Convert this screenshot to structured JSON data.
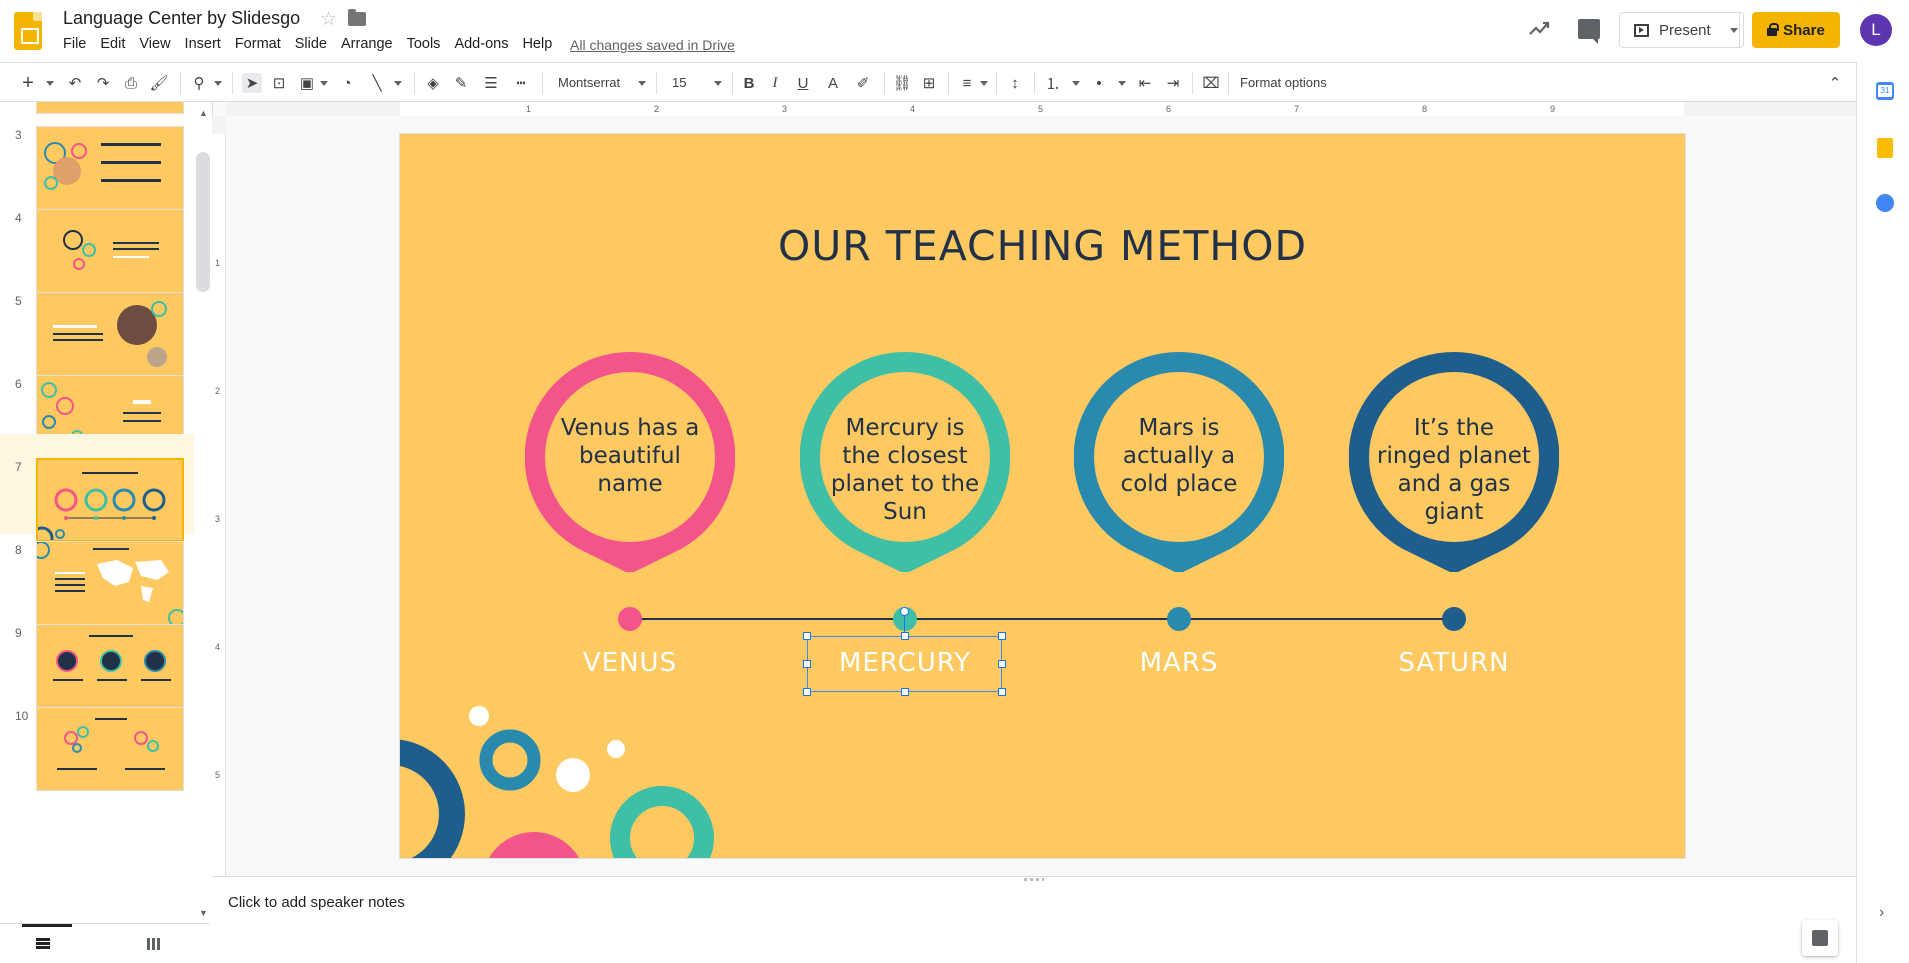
{
  "app": {
    "doc_title": "Language Center by Slidesgo",
    "menu": [
      "File",
      "Edit",
      "View",
      "Insert",
      "Format",
      "Slide",
      "Arrange",
      "Tools",
      "Add-ons",
      "Help"
    ],
    "save_status": "All changes saved in Drive",
    "present_label": "Present",
    "share_label": "Share",
    "avatar_letter": "L"
  },
  "toolbar": {
    "font_name": "Montserrat",
    "font_size": "15",
    "format_options": "Format options"
  },
  "filmstrip": {
    "slides": [
      {
        "num": "3"
      },
      {
        "num": "4"
      },
      {
        "num": "5"
      },
      {
        "num": "6"
      },
      {
        "num": "7",
        "active": true
      },
      {
        "num": "8"
      },
      {
        "num": "9"
      },
      {
        "num": "10"
      }
    ]
  },
  "ruler": {
    "h_marks": [
      "1",
      "2",
      "3",
      "4",
      "5",
      "6",
      "7",
      "8",
      "9"
    ],
    "v_marks": [
      "1",
      "2",
      "3",
      "4",
      "5"
    ]
  },
  "slide": {
    "title": "OUR TEACHING METHOD",
    "pins": [
      {
        "text": "Venus has a beautiful name",
        "label": "VENUS",
        "color": "#f3548a"
      },
      {
        "text": "Mercury is the closest planet to the Sun",
        "label": "MERCURY",
        "color": "#3ebfa6"
      },
      {
        "text": "Mars is actually a cold place",
        "label": "MARS",
        "color": "#2a8aad"
      },
      {
        "text": "It’s the ringed planet and a gas giant",
        "label": "SATURN",
        "color": "#1f5d8c"
      }
    ],
    "background": "#fec960",
    "text_color": "#213147"
  },
  "notes": {
    "placeholder": "Click to add speaker notes"
  },
  "colors": {
    "accent": "#f4b400",
    "selection": "#1a73e8"
  }
}
